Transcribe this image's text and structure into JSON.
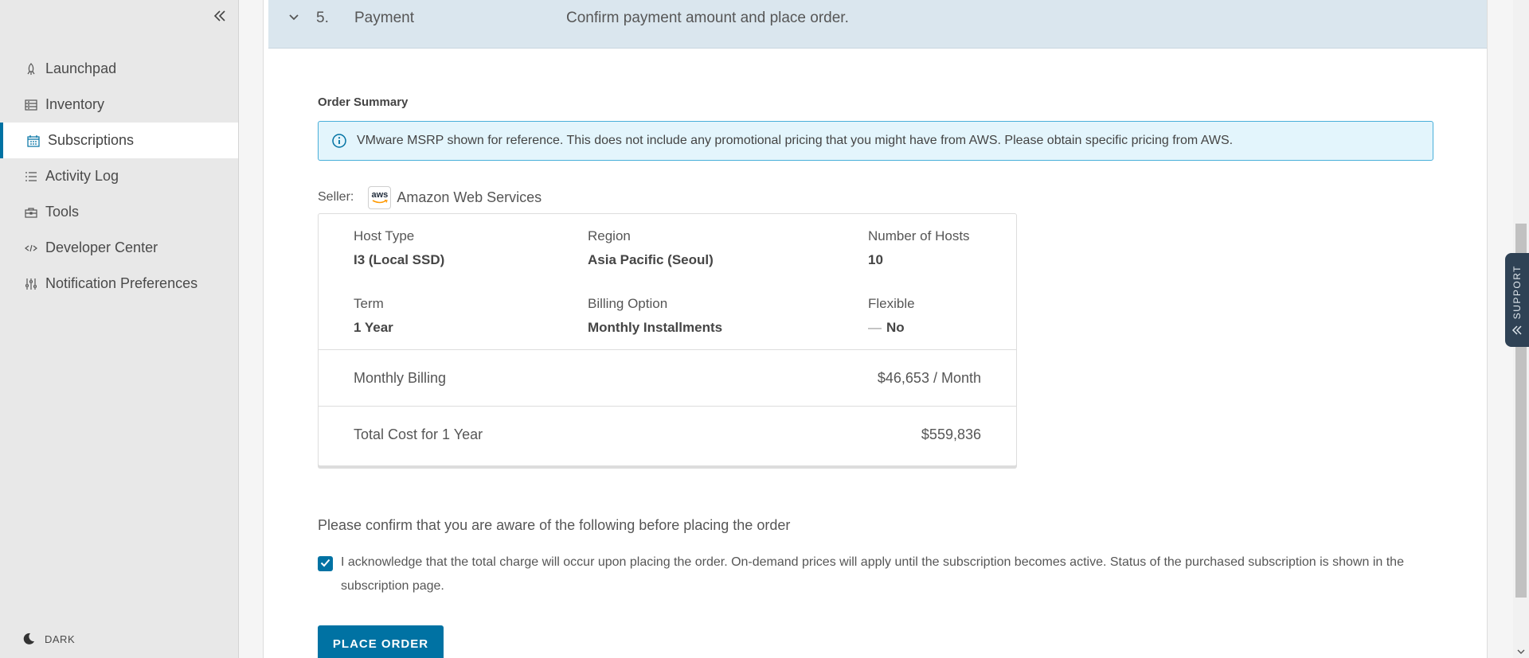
{
  "sidebar": {
    "collapse_icon": "double-chevron-left-icon",
    "items": [
      {
        "label": "Launchpad",
        "icon": "rocket-icon",
        "active": false
      },
      {
        "label": "Inventory",
        "icon": "inventory-icon",
        "active": false
      },
      {
        "label": "Subscriptions",
        "icon": "calendar-icon",
        "active": true
      },
      {
        "label": "Activity Log",
        "icon": "list-icon",
        "active": false
      },
      {
        "label": "Tools",
        "icon": "toolbox-icon",
        "active": false
      },
      {
        "label": "Developer Center",
        "icon": "code-icon",
        "active": false
      },
      {
        "label": "Notification Preferences",
        "icon": "sliders-icon",
        "active": false
      }
    ],
    "theme_label": "DARK",
    "theme_icon": "moon-icon"
  },
  "step": {
    "number": "5.",
    "title": "Payment",
    "description": "Confirm payment amount and place order."
  },
  "order_summary": {
    "label": "Order Summary",
    "alert_text": "VMware MSRP shown for reference. This does not include any promotional pricing that you might have from AWS. Please obtain specific pricing from AWS.",
    "seller_label": "Seller:",
    "seller_logo_text": "aws",
    "seller_name": "Amazon Web Services",
    "fields": {
      "host_type": {
        "label": "Host Type",
        "value": "I3 (Local SSD)"
      },
      "region": {
        "label": "Region",
        "value": "Asia Pacific (Seoul)"
      },
      "hosts": {
        "label": "Number of Hosts",
        "value": "10"
      },
      "term": {
        "label": "Term",
        "value": "1 Year"
      },
      "billing": {
        "label": "Billing Option",
        "value": "Monthly Installments"
      },
      "flexible": {
        "label": "Flexible",
        "dash": "—",
        "value": "No"
      }
    },
    "monthly_billing": {
      "label": "Monthly Billing",
      "value": "$46,653 / Month"
    },
    "total_cost": {
      "label": "Total Cost for 1 Year",
      "value": "$559,836"
    }
  },
  "confirmation": {
    "heading": "Please confirm that you are aware of the following before placing the order",
    "acknowledge_checked": true,
    "acknowledge_text": "I acknowledge that the total charge will occur upon placing the order. On-demand prices will apply until the subscription becomes active. Status of the purchased subscription is shown in the subscription page."
  },
  "place_order_label": "PLACE ORDER",
  "support_label": "SUPPORT",
  "colors": {
    "accent": "#0072a3",
    "step_header_bg": "#dae6ee",
    "alert_bg": "#e3f5fc",
    "alert_border": "#49afd9",
    "sidebar_bg": "#e8e8e8",
    "support_tab_bg": "#2f4255"
  }
}
